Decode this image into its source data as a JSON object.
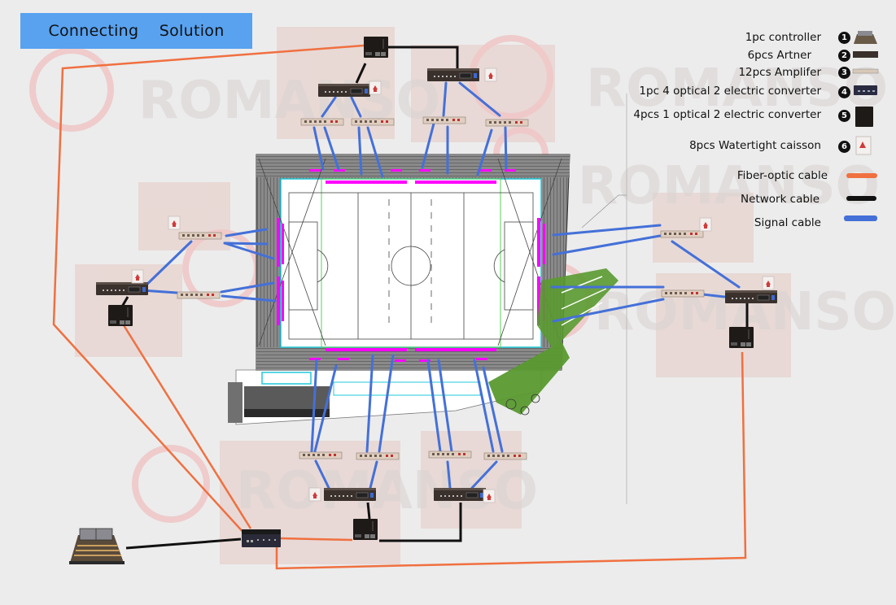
{
  "title": {
    "word1": "Connecting",
    "word2": "Solution"
  },
  "watermark": "ROMANSO",
  "legend": {
    "devices": [
      {
        "num": "1",
        "label": "1pc controller",
        "icon": "controller-console-icon"
      },
      {
        "num": "2",
        "label": "6pcs Artner",
        "icon": "artner-rack-icon"
      },
      {
        "num": "3",
        "label": "12pcs Amplifer",
        "icon": "amplifier-strip-icon"
      },
      {
        "num": "4",
        "label": "1pc 4 optical 2 electric converter",
        "icon": "four-optical-converter-icon"
      },
      {
        "num": "5",
        "label": "4pcs 1 optical 2 electric converter",
        "icon": "one-optical-converter-icon"
      },
      {
        "num": "6",
        "label": "8pcs Watertight caisson",
        "icon": "watertight-caisson-icon"
      }
    ],
    "cables": [
      {
        "label": "Fiber-optic cable",
        "color": "#f07040"
      },
      {
        "label": "Network cable",
        "color": "#111111"
      },
      {
        "label": "Signal cable",
        "color": "#4470d8"
      }
    ]
  },
  "colors": {
    "title_bg": "#58a2f0",
    "fiber": "#f07040",
    "network": "#111111",
    "signal": "#4470d8",
    "led_strip": "#ff00ff",
    "grass": "#5a9a30",
    "zone": "#e8d6d2",
    "background": "#ececec"
  }
}
